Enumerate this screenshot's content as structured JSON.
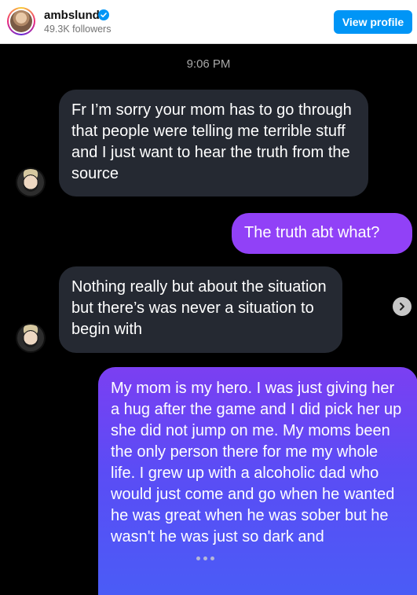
{
  "header": {
    "username": "ambslund",
    "followers": "49.3K followers",
    "view_profile_label": "View profile"
  },
  "chat": {
    "timestamp": "9:06 PM",
    "messages": [
      {
        "from": "them",
        "text": "Fr I’m sorry your mom has to go through that people were telling me terrible stuff and I just want to hear the truth from the source"
      },
      {
        "from": "me",
        "text": "The truth abt what?"
      },
      {
        "from": "them",
        "text": "Nothing really but about the situation but there’s was never a situation to begin with"
      },
      {
        "from": "me",
        "text": "My mom is my hero. I was just giving her a hug after the game and I did pick her up she did not jump on me. My moms been the only person there for me my whole life. I grew up with a alcoholic dad who would just come and go when he wanted he was great when he was sober but he wasn't he was just so dark and"
      }
    ]
  },
  "colors": {
    "accent": "#0095f6",
    "sent_bubble_top": "#7b3ff2",
    "sent_bubble_bottom": "#4a5cf6",
    "received_bubble": "#252932"
  },
  "icons": {
    "verified": "verified-badge-icon",
    "next": "chevron-right-icon"
  }
}
